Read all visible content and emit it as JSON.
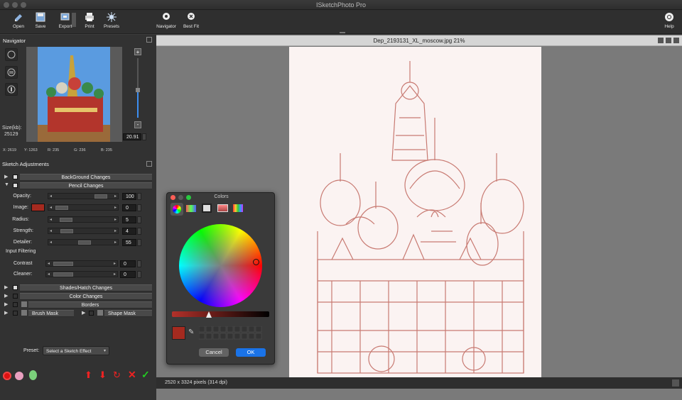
{
  "app": {
    "title": "ISketchPhoto Pro"
  },
  "toolbar": {
    "open": "Open",
    "save": "Save",
    "export": "Export",
    "print": "Print",
    "presets": "Presets",
    "navigator": "Navigator",
    "best_fit": "Best Fit",
    "help": "Help"
  },
  "navigator": {
    "title": "Navigator",
    "size_label": "Size(kb):",
    "size_value": "25129",
    "zoom_value": "20.91",
    "x": "X: 2619",
    "y": "Y: 1263",
    "r": "R: 235",
    "g": "G: 236",
    "b": "B: 235"
  },
  "sketch": {
    "title": "Sketch Adjustments",
    "sections": {
      "background": "BackGround Changes",
      "pencil": "Pencil Changes",
      "shades": "Shades/Hatch Changes",
      "color": "Color Changes",
      "borders": "Borders",
      "brush_mask": "Brush Mask",
      "shape_mask": "Shape Mask"
    },
    "opacity": {
      "label": "Opacity:",
      "value": "100",
      "level": 0.95
    },
    "image": {
      "label": "Image:",
      "value": "0",
      "level": 0.0,
      "swatch": "#a52a1f"
    },
    "radius": {
      "label": "Radius:",
      "value": "5",
      "level": 0.1
    },
    "strength": {
      "label": "Strength:",
      "value": "4",
      "level": 0.12
    },
    "detailer": {
      "label": "Detailer:",
      "value": "55",
      "level": 0.55
    },
    "input_filtering": "Input Filtering",
    "contrast": {
      "label": "Contrast",
      "value": "0",
      "level": 0.0
    },
    "cleaner": {
      "label": "Cleaner:",
      "value": "0",
      "level": 0.0
    }
  },
  "preset": {
    "label": "Preset:",
    "selected": "Select a Sketch Effect"
  },
  "document": {
    "title": "Dep_2193131_XL_moscow.jpg 21%"
  },
  "status": {
    "text": "2520 x 3324 pixels (314 dpi)"
  },
  "colors_panel": {
    "title": "Colors",
    "cancel": "Cancel",
    "ok": "OK",
    "current_color": "#a52a1f",
    "accent": "#1a73e8"
  }
}
